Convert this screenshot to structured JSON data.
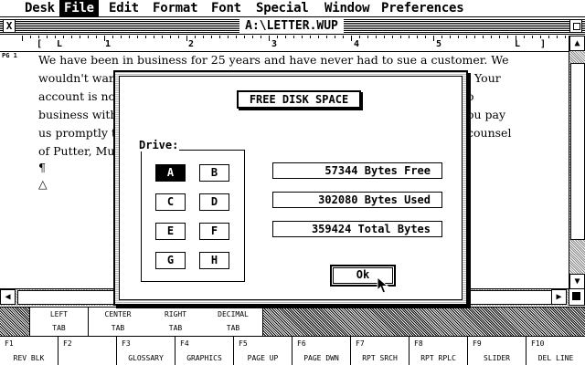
{
  "menubar": {
    "items": [
      "Desk",
      "File",
      "Edit",
      "Format",
      "Font",
      "Special",
      "Window",
      "Preferences"
    ],
    "active": "File"
  },
  "window": {
    "title": "A:\\LETTER.WUP",
    "close_glyph": "X",
    "page_marker": "PG 1"
  },
  "ruler": {
    "markers": [
      "[",
      "L",
      "1",
      "2",
      "3",
      "4",
      "5",
      "L",
      "]"
    ]
  },
  "document": {
    "lines": [
      "We have been in business for 25 years and have never had to sue a customer.  We",
      "wouldn't want",
      "account is nov",
      "business with",
      "us promptly to",
      "of Putter, Mut",
      "¶",
      "△"
    ],
    "right_fragments": [
      "Your",
      "o",
      "ou pay",
      "counsel"
    ]
  },
  "tabs": [
    {
      "l1": "LEFT",
      "l2": "TAB"
    },
    {
      "l1": "CENTER",
      "l2": "TAB"
    },
    {
      "l1": "RIGHT",
      "l2": "TAB"
    },
    {
      "l1": "DECIMAL",
      "l2": "TAB"
    }
  ],
  "fkeys": [
    {
      "num": "F1",
      "label": "REV BLK"
    },
    {
      "num": "F2",
      "label": ""
    },
    {
      "num": "F3",
      "label": "GLOSSARY"
    },
    {
      "num": "F4",
      "label": "GRAPHICS"
    },
    {
      "num": "F5",
      "label": "PAGE UP"
    },
    {
      "num": "F6",
      "label": "PAGE DWN"
    },
    {
      "num": "F7",
      "label": "RPT SRCH"
    },
    {
      "num": "F8",
      "label": "RPT RPLC"
    },
    {
      "num": "F9",
      "label": "SLIDER"
    },
    {
      "num": "F10",
      "label": "DEL LINE"
    }
  ],
  "dialog": {
    "title": "FREE DISK SPACE",
    "drive_label": "Drive:",
    "drives": [
      "A",
      "B",
      "C",
      "D",
      "E",
      "F",
      "G",
      "H"
    ],
    "selected_drive": "A",
    "bytes_free": "57344 Bytes Free",
    "bytes_used": "302080 Bytes Used",
    "total_bytes": "359424 Total Bytes",
    "ok_label": "Ok"
  },
  "scroll": {
    "up_glyph": "▲",
    "down_glyph": "▼",
    "left_glyph": "◀",
    "right_glyph": "▶"
  }
}
